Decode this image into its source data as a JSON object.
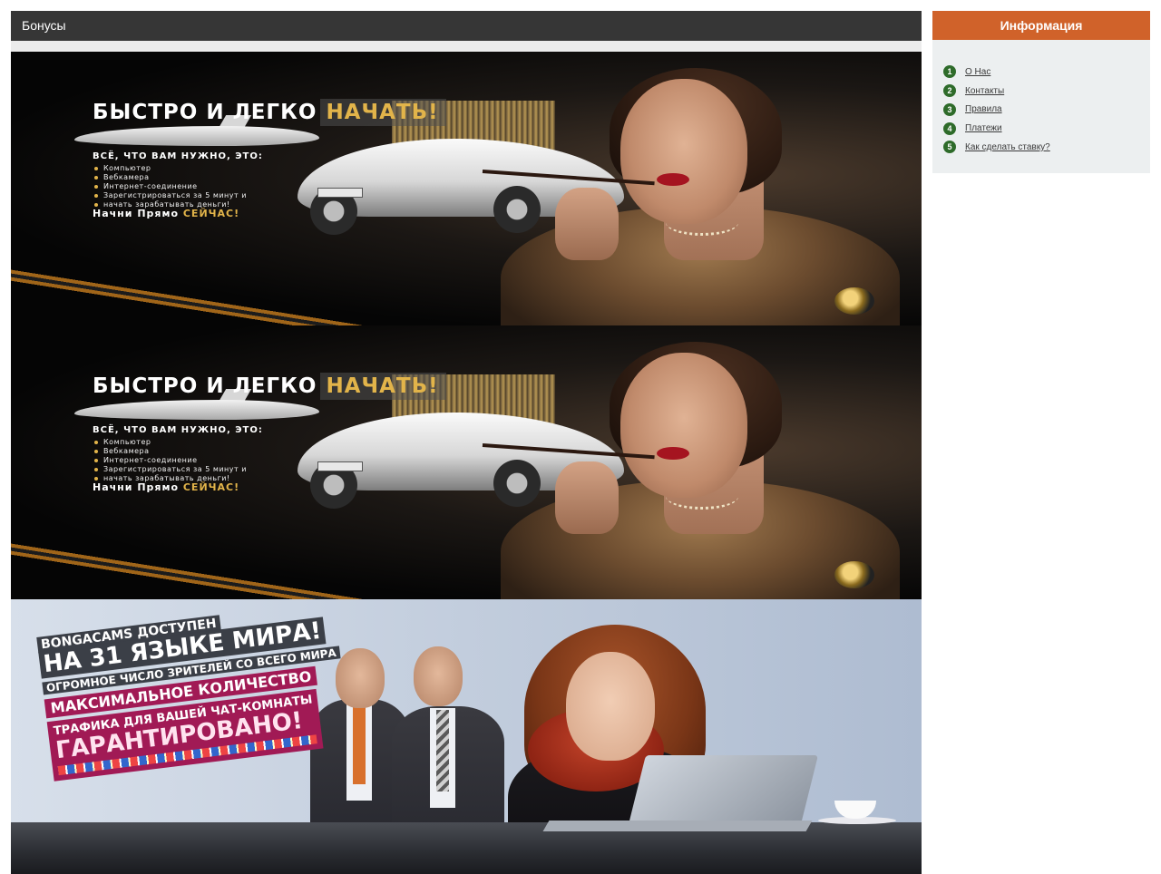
{
  "main": {
    "section_title": "Бонусы",
    "banner_start": {
      "title_white": "БЫСТРО И ЛЕГКО",
      "title_gold": "НАЧАТЬ!",
      "need_heading": "ВСЁ, ЧТО ВАМ НУЖНО, ЭТО:",
      "items": [
        "Компьютер",
        "Вебкамера",
        "Интернет-соединение",
        "Зарегистрироваться за 5 минут и",
        "начать зарабатывать деньги!"
      ],
      "cta_white": "Начни Прямо",
      "cta_gold": "СЕЙЧАС!",
      "plate_text": "BONGACAMS"
    },
    "banner_languages": {
      "line1": "BONGACAMS ДОСТУПЕН",
      "line2": "НА 31 ЯЗЫКЕ МИРА!",
      "line3": "ОГРОМНОЕ ЧИСЛО ЗРИТЕЛЕЙ СО ВСЕГО МИРА",
      "line4": "МАКСИМАЛЬНОЕ КОЛИЧЕСТВО",
      "line5": "ТРАФИКА ДЛЯ ВАШЕЙ ЧАТ-КОМНАТЫ",
      "line6": "ГАРАНТИРОВАНО!"
    }
  },
  "sidebar": {
    "title": "Информация",
    "links": [
      {
        "num": "1",
        "label": "О Нас"
      },
      {
        "num": "2",
        "label": "Контакты"
      },
      {
        "num": "3",
        "label": "Правила"
      },
      {
        "num": "4",
        "label": "Платежи"
      },
      {
        "num": "5",
        "label": "Как сделать ставку?"
      }
    ]
  },
  "colors": {
    "header_bg": "#363636",
    "sidebar_header_bg": "#d0622a",
    "number_badge": "#2e6b2a",
    "gold_text": "#e2b44a",
    "magenta_band": "#a11a55"
  }
}
